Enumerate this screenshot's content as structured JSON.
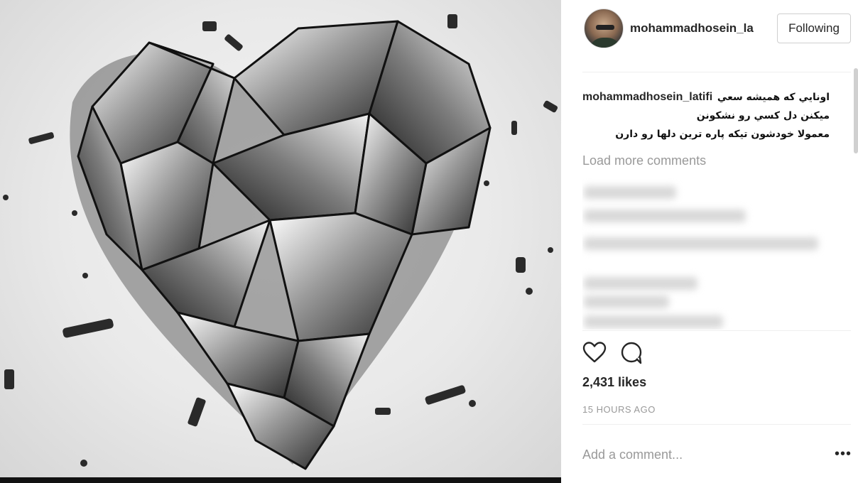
{
  "post": {
    "image_icon": "broken-glass-heart"
  },
  "header": {
    "username": "mohammadhosein_la",
    "follow_label": "Following"
  },
  "caption": {
    "username": "mohammadhosein_latifi",
    "text": "اونايي كه هميشه سعي\nميكنن دل كسي رو نشكونن\nمعمولا خودشون تيكه پاره ترين دلها رو دارن"
  },
  "comments": {
    "load_more": "Load more comments"
  },
  "actions": {
    "like_icon": "heart-icon",
    "comment_icon": "comment-icon"
  },
  "likes": "2,431 likes",
  "timestamp": "15 HOURS AGO",
  "add_comment": {
    "placeholder": "Add a comment..."
  },
  "more_label": "•••"
}
